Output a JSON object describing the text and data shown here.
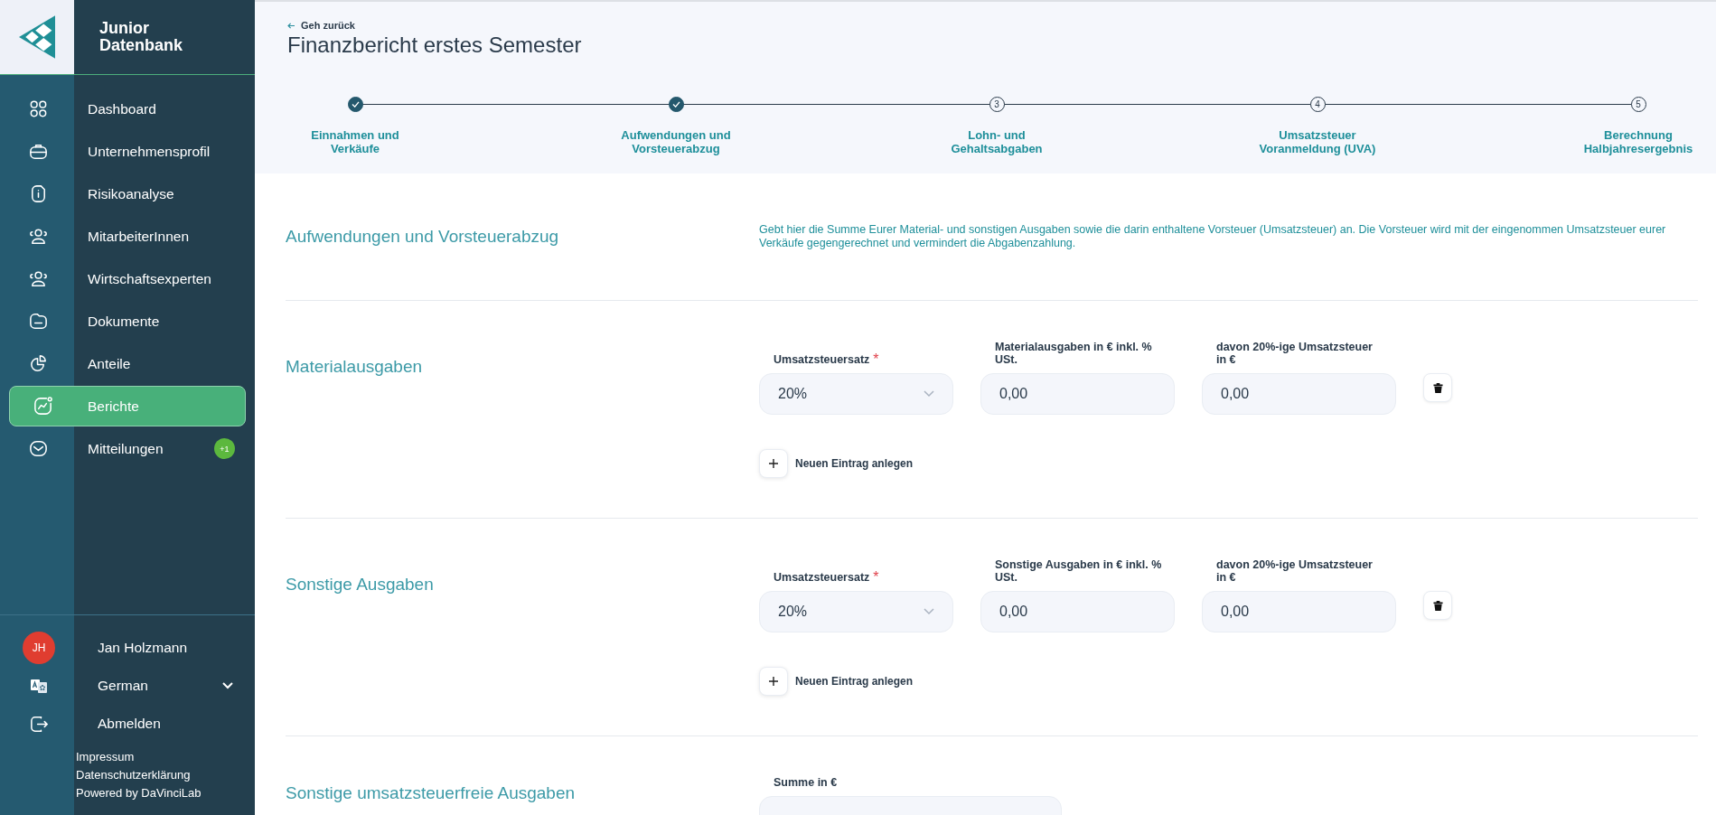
{
  "brand": {
    "name": "Junior Datenbank"
  },
  "nav": [
    {
      "label": "Dashboard",
      "selected": false
    },
    {
      "label": "Unternehmensprofil",
      "selected": false
    },
    {
      "label": "Risikoanalyse",
      "selected": false
    },
    {
      "label": "MitarbeiterInnen",
      "selected": false
    },
    {
      "label": "Wirtschaftsexperten",
      "selected": false
    },
    {
      "label": "Dokumente",
      "selected": false
    },
    {
      "label": "Anteile",
      "selected": false
    },
    {
      "label": "Berichte",
      "selected": true
    },
    {
      "label": "Mitteilungen",
      "selected": false,
      "badge": "+1"
    }
  ],
  "user": {
    "initials": "JH",
    "name": "Jan Holzmann"
  },
  "language": {
    "value": "German"
  },
  "logout": {
    "label": "Abmelden"
  },
  "footer_links": [
    "Impressum",
    "Datenschutzerklärung",
    "Powered by DaVinciLab"
  ],
  "back": "Geh zurück",
  "title": "Finanzbericht erstes Semester",
  "steps": [
    {
      "label": "Einnahmen und\nVerkäufe",
      "done": true
    },
    {
      "label": "Aufwendungen und\nVorsteuerabzug",
      "done": true
    },
    {
      "label": "Lohn- und\nGehaltsabgaben",
      "done": false,
      "number": "3"
    },
    {
      "label": "Umsatzsteuer\nVoranmeldung (UVA)",
      "done": false,
      "number": "4"
    },
    {
      "label": "Berechnung\nHalbjahresergebnis",
      "done": false,
      "number": "5"
    }
  ],
  "sections": [
    {
      "kind": "intro",
      "title": "Aufwendungen und Vorsteuerabzug",
      "description": "Gebt hier die Summe Eurer Material- und sonstigen Ausgaben sowie die darin enthaltene Vorsteuer (Umsatzsteuer) an. Die Vorsteuer wird mit der eingenommen Umsatzsteuer eurer Verkäufe gegengerechnet und vermindert die Abgabenzahlung."
    },
    {
      "kind": "entries",
      "title": "Materialausgaben",
      "add_label": "Neuen Eintrag anlegen",
      "fields": [
        {
          "kind": "select",
          "label": "Umsatzsteuersatz",
          "required_mark": "*",
          "value": "20%"
        },
        {
          "kind": "input",
          "label": "Materialausgaben in € inkl. %\nUSt.",
          "value": "0,00"
        },
        {
          "kind": "input",
          "label": "davon 20%-ige Umsatzsteuer\nin €",
          "value": "0,00"
        }
      ]
    },
    {
      "kind": "entries",
      "title": "Sonstige Ausgaben",
      "add_label": "Neuen Eintrag anlegen",
      "fields": [
        {
          "kind": "select",
          "label": "Umsatzsteuersatz",
          "required_mark": "*",
          "value": "20%"
        },
        {
          "kind": "input",
          "label": "Sonstige Ausgaben in € inkl. %\nUSt.",
          "value": "0,00"
        },
        {
          "kind": "input",
          "label": "davon 20%-ige Umsatzsteuer\nin €",
          "value": "0,00"
        }
      ]
    },
    {
      "kind": "sum",
      "title": "Sonstige umsatzsteuerfreie Ausgaben",
      "fields": [
        {
          "kind": "wide",
          "label": "Summe in €"
        }
      ]
    }
  ]
}
